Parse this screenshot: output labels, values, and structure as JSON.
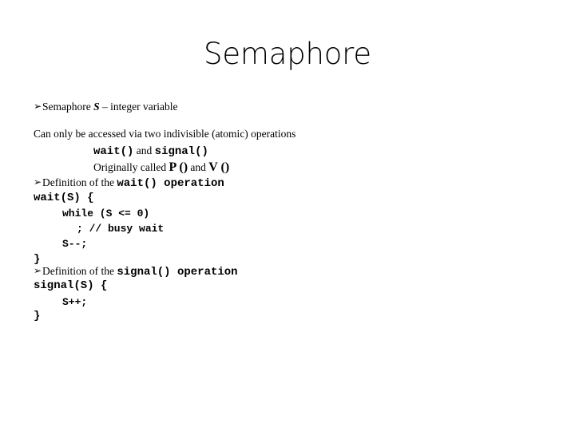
{
  "slide": {
    "title": "Semaphore",
    "background_color": "#ffffff",
    "text_color": "#000000",
    "bullet_glyph": "➢",
    "bullet_icon_name": "arrowhead-bullet-icon"
  },
  "body": {
    "semaphore_def": {
      "lead": "Semaphore ",
      "variable": "S",
      "tail": " – integer variable"
    },
    "accessed_line": "Can only be accessed via two indivisible (atomic) operations",
    "operations_line": {
      "wait": "wait()",
      "conjunction": " and ",
      "signal": "signal()"
    },
    "originally_line": {
      "lead": "Originally called ",
      "p": "P ()",
      "conjunction": "  and ",
      "v": "V ()"
    },
    "definition_wait": {
      "lead": "Definition of the ",
      "code": "wait()  operation"
    },
    "wait_code": [
      "wait(S) {",
      "while (S <= 0)",
      "; // busy wait",
      "S--;",
      "}"
    ],
    "definition_signal": {
      "lead": "Definition of the ",
      "code": "signal()  operation"
    },
    "signal_code": [
      "signal(S) {",
      "S++;",
      "}"
    ]
  }
}
